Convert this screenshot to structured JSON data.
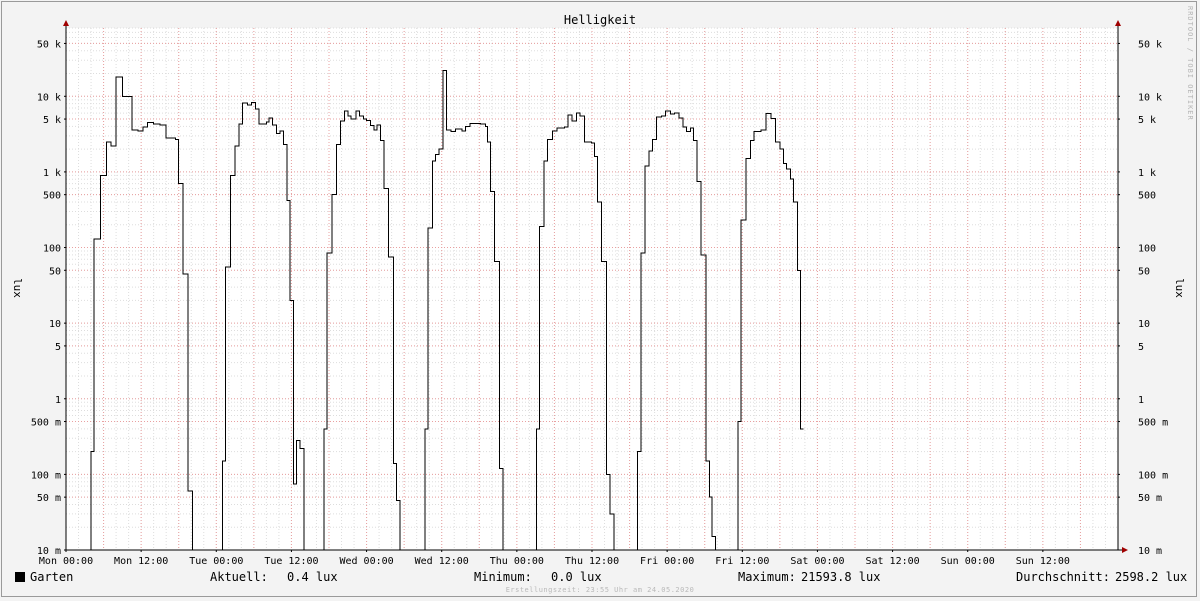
{
  "chart_data": {
    "type": "line",
    "title": "Helligkeit",
    "ylabel": "lux",
    "yscale": "log",
    "ylim": [
      0.01,
      80000
    ],
    "xlim": [
      0,
      168
    ],
    "x_unit": "hours since Mon 00:00",
    "grid": true,
    "x_ticks": [
      {
        "x": 0,
        "label": "Mon 00:00"
      },
      {
        "x": 12,
        "label": "Mon 12:00"
      },
      {
        "x": 24,
        "label": "Tue 00:00"
      },
      {
        "x": 36,
        "label": "Tue 12:00"
      },
      {
        "x": 48,
        "label": "Wed 00:00"
      },
      {
        "x": 60,
        "label": "Wed 12:00"
      },
      {
        "x": 72,
        "label": "Thu 00:00"
      },
      {
        "x": 84,
        "label": "Thu 12:00"
      },
      {
        "x": 96,
        "label": "Fri 00:00"
      },
      {
        "x": 108,
        "label": "Fri 12:00"
      },
      {
        "x": 120,
        "label": "Sat 00:00"
      },
      {
        "x": 132,
        "label": "Sat 12:00"
      },
      {
        "x": 144,
        "label": "Sun 00:00"
      },
      {
        "x": 156,
        "label": "Sun 12:00"
      }
    ],
    "y_ticks": [
      {
        "value": 0.01,
        "label": "10 m"
      },
      {
        "value": 0.05,
        "label": "50 m"
      },
      {
        "value": 0.1,
        "label": "100 m"
      },
      {
        "value": 0.5,
        "label": "500 m"
      },
      {
        "value": 1,
        "label": "1"
      },
      {
        "value": 5,
        "label": "5"
      },
      {
        "value": 10,
        "label": "10"
      },
      {
        "value": 50,
        "label": "50"
      },
      {
        "value": 100,
        "label": "100"
      },
      {
        "value": 500,
        "label": "500"
      },
      {
        "value": 1000,
        "label": "1 k"
      },
      {
        "value": 5000,
        "label": "5 k"
      },
      {
        "value": 10000,
        "label": "10 k"
      },
      {
        "value": 50000,
        "label": "50 k"
      }
    ],
    "series": [
      {
        "name": "Garten",
        "color": "#000000",
        "step": true,
        "points": [
          [
            0,
            0.005
          ],
          [
            2,
            0.005
          ],
          [
            4,
            0.2
          ],
          [
            4.5,
            130
          ],
          [
            5.5,
            900
          ],
          [
            6.5,
            2500
          ],
          [
            7.2,
            2200
          ],
          [
            8,
            18000
          ],
          [
            9,
            10000
          ],
          [
            10.5,
            3600
          ],
          [
            11.5,
            3500
          ],
          [
            12.3,
            3900
          ],
          [
            13,
            4500
          ],
          [
            14,
            4300
          ],
          [
            15,
            4200
          ],
          [
            16,
            2800
          ],
          [
            17.5,
            2700
          ],
          [
            18,
            700
          ],
          [
            18.7,
            45
          ],
          [
            19.5,
            0.06
          ],
          [
            20.2,
            0.005
          ],
          [
            22,
            0.005
          ],
          [
            24.5,
            0.005
          ],
          [
            25,
            0.15
          ],
          [
            25.5,
            55
          ],
          [
            26.3,
            900
          ],
          [
            27,
            2200
          ],
          [
            27.6,
            4300
          ],
          [
            28.2,
            8200
          ],
          [
            29,
            7700
          ],
          [
            29.6,
            8300
          ],
          [
            30.3,
            6800
          ],
          [
            30.8,
            4300
          ],
          [
            32,
            4600
          ],
          [
            32.4,
            5200
          ],
          [
            33,
            4200
          ],
          [
            33.6,
            3200
          ],
          [
            34.2,
            3500
          ],
          [
            34.7,
            2300
          ],
          [
            35.3,
            420
          ],
          [
            35.8,
            20
          ],
          [
            36.3,
            0.075
          ],
          [
            36.8,
            0.28
          ],
          [
            37.4,
            0.22
          ],
          [
            38,
            0.005
          ],
          [
            40,
            0.005
          ],
          [
            41.2,
            0.4
          ],
          [
            41.7,
            85
          ],
          [
            42.5,
            500
          ],
          [
            43.2,
            2300
          ],
          [
            43.8,
            4700
          ],
          [
            44.5,
            6400
          ],
          [
            45,
            5500
          ],
          [
            45.5,
            5000
          ],
          [
            46.3,
            6400
          ],
          [
            46.9,
            5500
          ],
          [
            47.5,
            5000
          ],
          [
            48,
            4800
          ],
          [
            48.6,
            4100
          ],
          [
            49.2,
            3600
          ],
          [
            49.7,
            4200
          ],
          [
            50.2,
            2600
          ],
          [
            50.8,
            600
          ],
          [
            51.5,
            75
          ],
          [
            52.3,
            0.14
          ],
          [
            52.8,
            0.045
          ],
          [
            53.3,
            0.005
          ],
          [
            55,
            0.005
          ],
          [
            57.3,
            0.4
          ],
          [
            57.8,
            180
          ],
          [
            58.5,
            1400
          ],
          [
            59,
            1700
          ],
          [
            59.6,
            2000
          ],
          [
            60.2,
            22000
          ],
          [
            60.8,
            3600
          ],
          [
            61.5,
            3400
          ],
          [
            62.2,
            3700
          ],
          [
            63.2,
            3500
          ],
          [
            63.8,
            4000
          ],
          [
            64.5,
            4400
          ],
          [
            66.2,
            4300
          ],
          [
            67,
            4000
          ],
          [
            67.3,
            2500
          ],
          [
            67.8,
            550
          ],
          [
            68.4,
            65
          ],
          [
            69.2,
            0.12
          ],
          [
            69.8,
            0.005
          ],
          [
            72,
            0.005
          ],
          [
            74.5,
            0.005
          ],
          [
            75.1,
            0.4
          ],
          [
            75.6,
            190
          ],
          [
            76.3,
            1400
          ],
          [
            76.9,
            2700
          ],
          [
            77.7,
            3500
          ],
          [
            78.4,
            3800
          ],
          [
            79.6,
            3900
          ],
          [
            80.2,
            5700
          ],
          [
            80.8,
            4700
          ],
          [
            81.5,
            6000
          ],
          [
            82.1,
            5500
          ],
          [
            82.8,
            2500
          ],
          [
            83.9,
            2400
          ],
          [
            84.4,
            1600
          ],
          [
            84.9,
            400
          ],
          [
            85.5,
            65
          ],
          [
            86.3,
            0.1
          ],
          [
            86.9,
            0.03
          ],
          [
            87.5,
            0.005
          ],
          [
            89,
            0.005
          ],
          [
            91.3,
            0.2
          ],
          [
            91.8,
            85
          ],
          [
            92.5,
            1200
          ],
          [
            93.1,
            1900
          ],
          [
            93.7,
            2700
          ],
          [
            94.3,
            5300
          ],
          [
            95.1,
            5500
          ],
          [
            95.7,
            6400
          ],
          [
            96.5,
            5800
          ],
          [
            97.2,
            6000
          ],
          [
            97.9,
            5200
          ],
          [
            98.5,
            3900
          ],
          [
            99.1,
            3400
          ],
          [
            99.7,
            3800
          ],
          [
            100.2,
            2600
          ],
          [
            100.8,
            750
          ],
          [
            101.4,
            80
          ],
          [
            102.2,
            0.15
          ],
          [
            102.8,
            0.05
          ],
          [
            103.2,
            0.015
          ],
          [
            103.7,
            0.005
          ],
          [
            105,
            0.005
          ],
          [
            107.3,
            0.5
          ],
          [
            107.8,
            230
          ],
          [
            108.6,
            1500
          ],
          [
            109.3,
            2600
          ],
          [
            109.9,
            3400
          ],
          [
            111,
            3600
          ],
          [
            111.8,
            5900
          ],
          [
            112.6,
            5100
          ],
          [
            113.3,
            2500
          ],
          [
            114,
            2000
          ],
          [
            114.6,
            1300
          ],
          [
            115.1,
            1100
          ],
          [
            115.7,
            800
          ],
          [
            116.2,
            400
          ],
          [
            116.8,
            50
          ],
          [
            117.3,
            0.4
          ],
          [
            117.8,
            0.4
          ]
        ]
      }
    ],
    "legend": {
      "name": "Garten",
      "current_label": "Aktuell:",
      "current_value": "0.4 lux",
      "min_label": "Minimum:",
      "min_value": "0.0 lux",
      "max_label": "Maximum:",
      "max_value": "21593.8 lux",
      "avg_label": "Durchschnitt:",
      "avg_value": "2598.2 lux"
    }
  },
  "footer": {
    "created": "Erstellungszeit: 23:55 Uhr am 24.05.2020"
  },
  "watermark": "RRDTOOL / TOBI OETIKER",
  "colors": {
    "background": "#f3f3f3",
    "canvas": "#ffffff",
    "grid_minor": "#dddddd",
    "grid_major": "#e9a0a0",
    "axis_arrow": "#a00000",
    "line": "#000000"
  }
}
